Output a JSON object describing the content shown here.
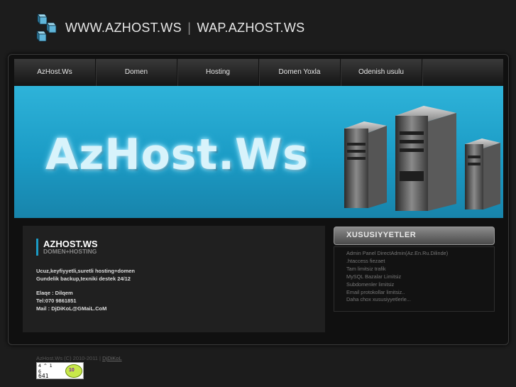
{
  "header": {
    "domain_main": "WWW.AZHOST.WS",
    "separator": "|",
    "domain_wap": "WAP.AZHOST.WS"
  },
  "nav": {
    "items": [
      {
        "label": "AzHost.Ws"
      },
      {
        "label": "Domen"
      },
      {
        "label": "Hosting"
      },
      {
        "label": "Domen Yoxla"
      },
      {
        "label": "Odenish usulu"
      }
    ]
  },
  "banner": {
    "text": "AzHost.Ws"
  },
  "content": {
    "title": "AZHOST.WS",
    "subtitle": "DOMEN+HOSTING",
    "line1": "Ucuz,keyfiyyetli,suretli hosting+domen",
    "line2": "Gundelik backup,texniki destek 24/12",
    "line3": "Elaqe : Dilqem",
    "line4": "Tel:070 9861851",
    "line5": "Mail : DjDiKoL@GMaiL.CoM"
  },
  "sidebar": {
    "title": "XUSUSIYYETLER",
    "items": [
      "Admin Panel DirectAdmin(Az.En.Ru.Dilinde)",
      ".htaccess fiezaet",
      "Tam limitsiz trafik",
      "MySQL Bazalar Limitsiz",
      "Subdomenler limitsiz",
      "Email protokollar limitsiz..",
      "Daha chox xususiyyetlerle..."
    ]
  },
  "footer": {
    "copyright": "AzHost.Ws (C) 2010-2011 |",
    "author_link": "DjDiKoL"
  },
  "counter": {
    "stats": "4 ^ 1\n6",
    "total": "641",
    "logo_text": "10"
  },
  "colors": {
    "accent": "#1b9bc5",
    "background": "#1c1c1c",
    "banner_top": "#2eb3d9"
  }
}
